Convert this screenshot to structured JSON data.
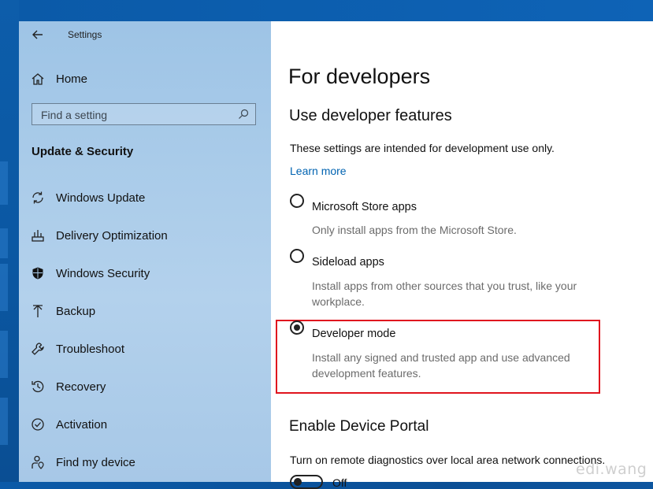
{
  "window": {
    "title": "Settings"
  },
  "sidebar": {
    "home_label": "Home",
    "search": {
      "placeholder": "Find a setting"
    },
    "section_header": "Update & Security",
    "items": [
      {
        "label": "Windows Update",
        "icon": "sync-icon"
      },
      {
        "label": "Delivery Optimization",
        "icon": "delivery-optimization-icon"
      },
      {
        "label": "Windows Security",
        "icon": "shield-icon"
      },
      {
        "label": "Backup",
        "icon": "backup-arrow-icon"
      },
      {
        "label": "Troubleshoot",
        "icon": "wrench-icon"
      },
      {
        "label": "Recovery",
        "icon": "recovery-icon"
      },
      {
        "label": "Activation",
        "icon": "check-circle-icon"
      },
      {
        "label": "Find my device",
        "icon": "person-location-icon"
      }
    ]
  },
  "main": {
    "title": "For developers",
    "subtitle": "Use developer features",
    "intro": "These settings are intended for development use only.",
    "learn_more": "Learn more",
    "options": [
      {
        "label": "Microsoft Store apps",
        "desc": "Only install apps from the Microsoft Store.",
        "selected": false
      },
      {
        "label": "Sideload apps",
        "desc": "Install apps from other sources that you trust, like your workplace.",
        "selected": false
      },
      {
        "label": "Developer mode",
        "desc": "Install any signed and trusted app and use advanced development features.",
        "selected": true
      }
    ],
    "portal": {
      "title": "Enable Device Portal",
      "desc": "Turn on remote diagnostics over local area network connections.",
      "toggle_label": "Off"
    }
  },
  "watermark": "edi.wang",
  "colors": {
    "accent": "#0063b1",
    "highlight_box": "#e0141e"
  }
}
